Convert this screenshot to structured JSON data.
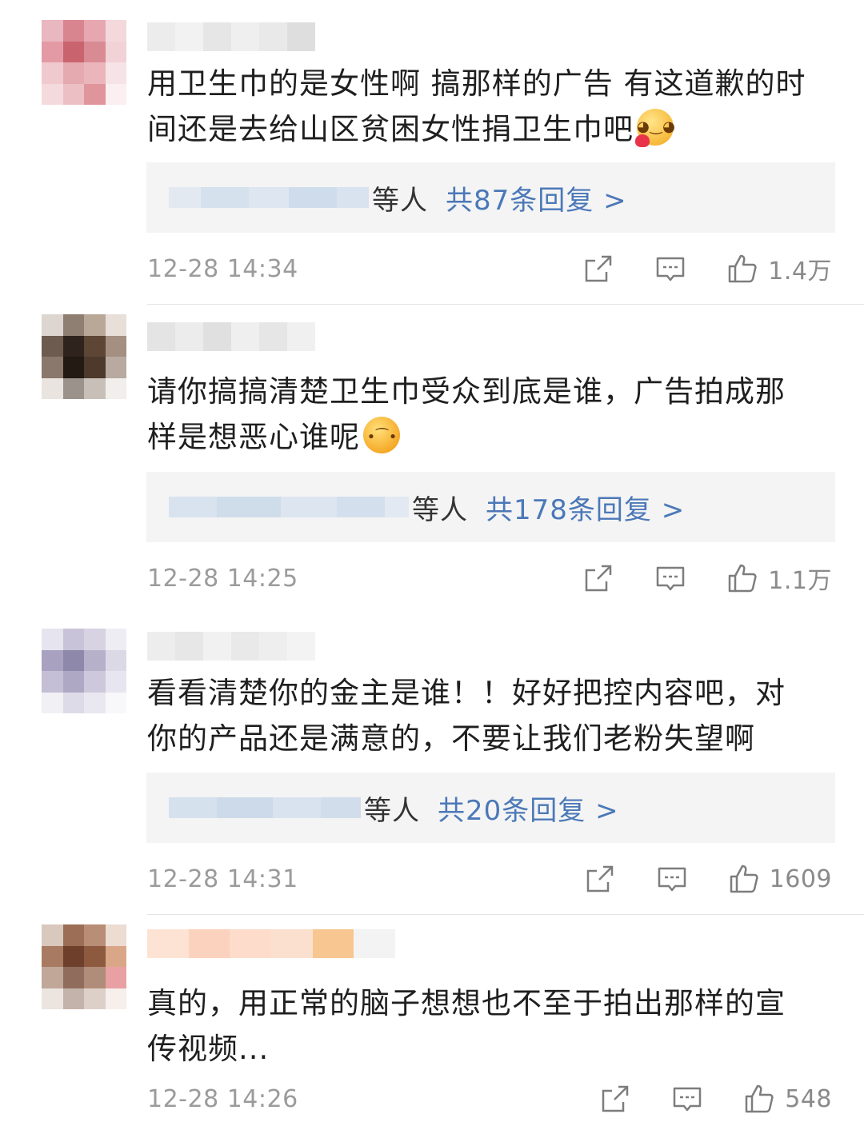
{
  "comments": [
    {
      "text": "用卫生巾的是女性啊 搞那样的广告 有这道歉的时\n间还是去给山区贫困女性捐卫生巾吧",
      "emoji": "shy-face-emoji",
      "reply_suffix": "等人",
      "reply_link": "共87条回复 >",
      "time": "12-28 14:34",
      "likes": "1.4万"
    },
    {
      "text": "请你搞搞清楚卫生巾受众到底是谁，广告拍成那\n样是想恶心谁呢",
      "emoji": "upside-down-face-emoji",
      "reply_suffix": "等人",
      "reply_link": "共178条回复 >",
      "time": "12-28 14:25",
      "likes": "1.1万"
    },
    {
      "text": "看看清楚你的金主是谁！！好好把控内容吧，对\n你的产品还是满意的，不要让我们老粉失望啊",
      "emoji": "",
      "reply_suffix": "等人",
      "reply_link": "共20条回复 >",
      "time": "12-28 14:31",
      "likes": "1609"
    },
    {
      "text": "真的，用正常的脑子想想也不至于拍出那样的宣\n传视频...",
      "emoji": "",
      "reply_suffix": "",
      "reply_link": "",
      "time": "12-28 14:26",
      "likes": "548"
    }
  ],
  "colors": {
    "reply_link": "#4b78b8",
    "meta_gray": "#9b9b9b",
    "reply_bg": "#f4f4f4"
  },
  "icons": [
    "share-icon",
    "comment-icon",
    "like-icon"
  ]
}
